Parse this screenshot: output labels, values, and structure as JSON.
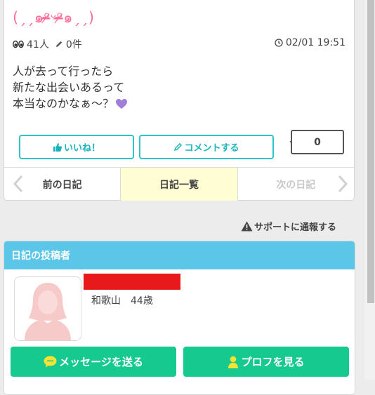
{
  "post": {
    "kaomoji": "(ˏˏ๑ᵒ̴̶̷ᵕᵒ̴̶̷๑ˏˏ)",
    "views": "41人",
    "comments": "0件",
    "date": "02/01 19:51",
    "body_lines": [
      "人が去って行ったら",
      "新たな出会いあるって",
      "本当なのかなぁ～？"
    ]
  },
  "actions": {
    "like_label": "いいね！",
    "comment_label": "コメントする",
    "like_count": "0"
  },
  "nav": {
    "prev_label": "前の日記",
    "list_label": "日記一覧",
    "next_label": "次の日記"
  },
  "report_label": "サポートに通報する",
  "author": {
    "section_title": "日記の投稿者",
    "location_age": "和歌山　44歳",
    "message_label": "メッセージを送る",
    "profile_label": "プロフを見る"
  },
  "colors": {
    "accent_teal": "#2ec4c8",
    "header_blue": "#5bc6e8",
    "green": "#16c98e",
    "kaomoji_pink": "#ff6e99",
    "heart_purple": "#a07fd8",
    "nav_highlight": "#fffdd4"
  },
  "icons": [
    "eyes-icon",
    "pencil-icon",
    "clock-icon",
    "heart-icon",
    "thumbs-up-icon",
    "chevron-left-icon",
    "chevron-right-icon",
    "warning-icon",
    "speech-bubble-icon",
    "person-icon"
  ]
}
